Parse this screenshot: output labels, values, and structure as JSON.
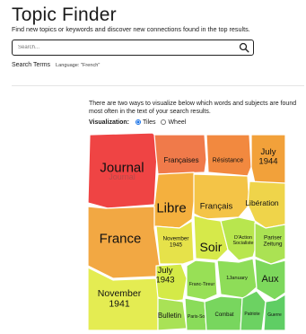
{
  "header": {
    "title": "Topic Finder",
    "subtitle": "Find new topics or keywords and discover new connections found in the top results."
  },
  "search": {
    "placeholder": "Search...",
    "value": ""
  },
  "search_terms": {
    "label": "Search Terms",
    "language": "Language: \"French\""
  },
  "visualization": {
    "intro": "There are two ways to visualize below which words and subjects are found most often in the text of your search results.",
    "label": "Visualization:",
    "options": [
      {
        "label": "Tiles",
        "selected": true
      },
      {
        "label": "Wheel",
        "selected": false
      }
    ]
  },
  "tiles": [
    {
      "label": "Journal",
      "ghost": "Journal",
      "color": "#ef4444"
    },
    {
      "label": "Françaises",
      "color": "#f07a4a"
    },
    {
      "label": "Résistance",
      "color": "#f2893f"
    },
    {
      "label": "July 1944",
      "color": "#f2a13a"
    },
    {
      "label": "Libre",
      "color": "#f4b03e"
    },
    {
      "label": "Français",
      "color": "#f4c447"
    },
    {
      "label": "Libération",
      "color": "#efd44a"
    },
    {
      "label": "France",
      "color": "#f2a843"
    },
    {
      "label": "November 1945",
      "color": "#e6e24a"
    },
    {
      "label": "Soir",
      "color": "#d6e94a"
    },
    {
      "label": "D'Action Socialiste",
      "color": "#b8e64e"
    },
    {
      "label": "Pariser Zeitung",
      "color": "#abe253"
    },
    {
      "label": "July 1943",
      "color": "#d4ea47"
    },
    {
      "label": "Franc-Tireur",
      "color": "#98e056"
    },
    {
      "label": "1January",
      "color": "#8edd58"
    },
    {
      "label": "Aux",
      "color": "#7dd85c"
    },
    {
      "label": "November 1941",
      "color": "#e4ec52"
    },
    {
      "label": "Bulletin",
      "color": "#a9e256"
    },
    {
      "label": "Paris-Soir",
      "color": "#8adc5a"
    },
    {
      "label": "Combat",
      "color": "#78d65e"
    },
    {
      "label": "Patriote",
      "color": "#6cd262"
    },
    {
      "label": "Guerre",
      "color": "#5fce64"
    }
  ]
}
